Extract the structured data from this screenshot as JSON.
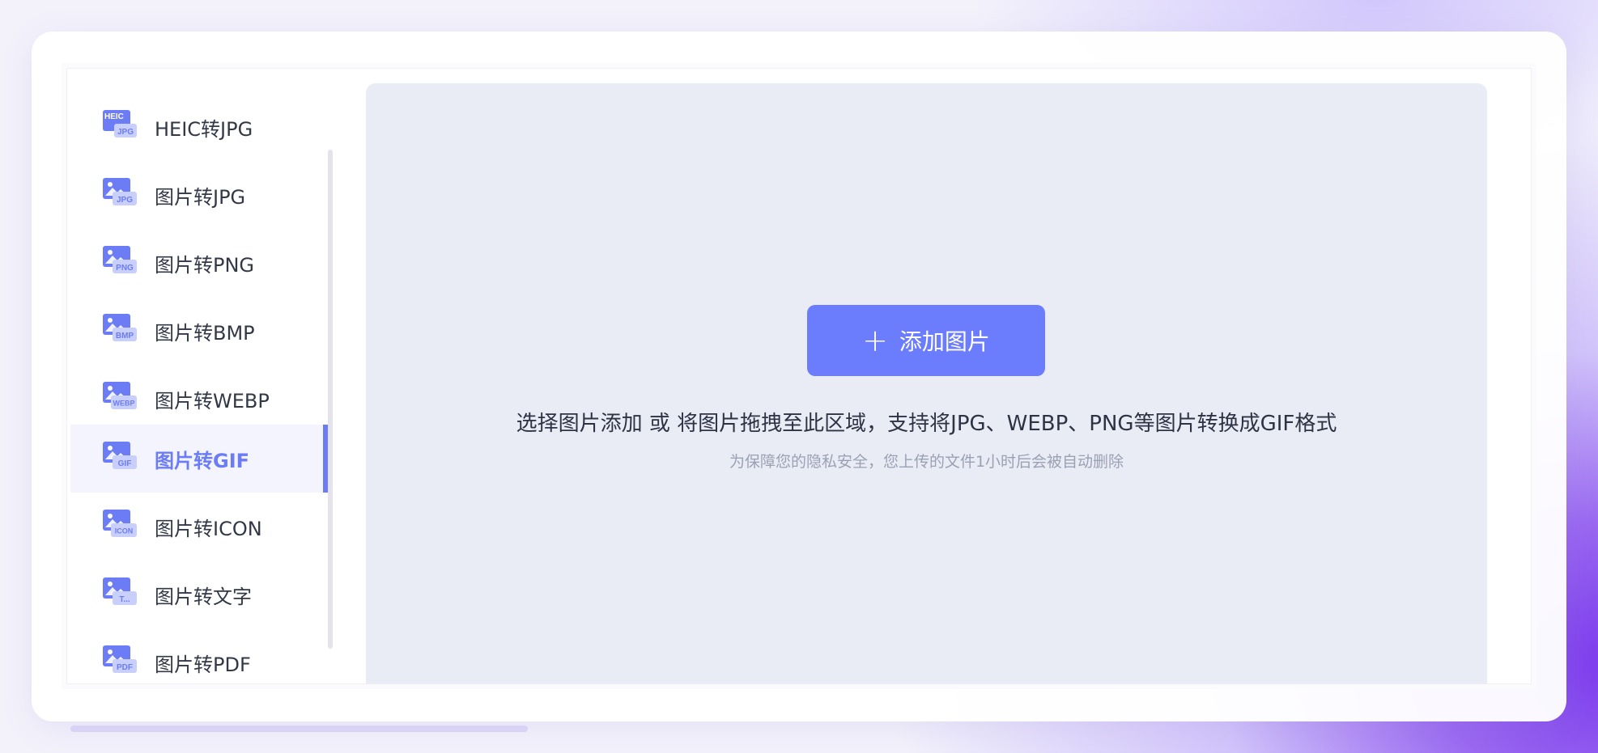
{
  "sidebar": {
    "items": [
      {
        "label": "HEIC转JPG",
        "badge": "JPG",
        "top_badge": "HEIC"
      },
      {
        "label": "图片转JPG",
        "badge": "JPG"
      },
      {
        "label": "图片转PNG",
        "badge": "PNG"
      },
      {
        "label": "图片转BMP",
        "badge": "BMP"
      },
      {
        "label": "图片转WEBP",
        "badge": "WEBP"
      },
      {
        "label": "图片转GIF",
        "badge": "GIF",
        "active": true
      },
      {
        "label": "图片转ICON",
        "badge": "ICON"
      },
      {
        "label": "图片转文字",
        "badge": "T..."
      },
      {
        "label": "图片转PDF",
        "badge": "PDF"
      }
    ]
  },
  "upload": {
    "button_label": "添加图片",
    "button_icon": "plus-icon",
    "instructions": "选择图片添加 或 将图片拖拽至此区域，支持将JPG、WEBP、PNG等图片转换成GIF格式",
    "privacy_note": "为保障您的隐私安全，您上传的文件1小时后会被自动删除"
  },
  "colors": {
    "accent": "#6b7cfc",
    "dropzone_bg": "#eaecf5",
    "active_item_bg": "#f3f4fe"
  }
}
